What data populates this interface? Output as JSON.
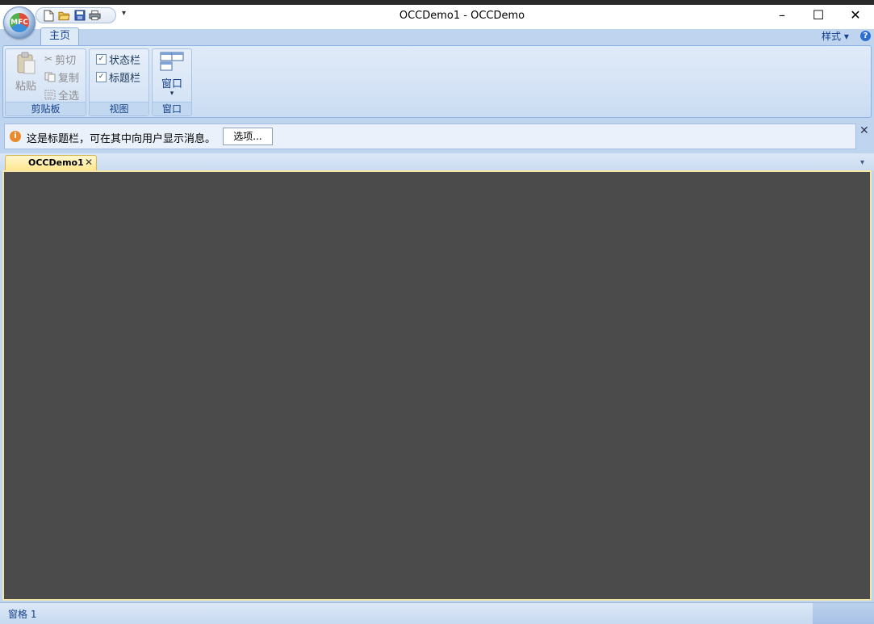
{
  "window": {
    "title": "OCCDemo1 - OCCDemo",
    "minimize_glyph": "–",
    "maximize_glyph": "☐",
    "close_glyph": "✕"
  },
  "app_button": {
    "logo_text": "MFC"
  },
  "quick_access": {
    "items": [
      "new-file-icon",
      "open-folder-icon",
      "save-disk-icon",
      "print-icon"
    ],
    "more_glyph": "▾"
  },
  "ribbon": {
    "tabs": [
      {
        "label": "主页",
        "active": true
      }
    ],
    "style_menu": "样式 ▾",
    "help_glyph": "?",
    "groups": {
      "clipboard": {
        "caption": "剪贴板",
        "paste": "粘贴",
        "cut": "剪切",
        "copy": "复制",
        "select_all": "全选"
      },
      "view": {
        "caption": "视图",
        "status_bar": "状态栏",
        "caption_bar": "标题栏",
        "check_glyph": "✓"
      },
      "window": {
        "caption": "窗口",
        "window_button": "窗口",
        "dropdown_glyph": "▾"
      }
    }
  },
  "message_bar": {
    "info_glyph": "i",
    "text": "这是标题栏，可在其中向用户显示消息。",
    "options_button": "选项...",
    "close_glyph": "✕"
  },
  "document_tabs": {
    "tabs": [
      {
        "label": "OCCDemo1",
        "active": true
      }
    ],
    "close_glyph": "✕",
    "more_glyph": "▾"
  },
  "status_bar": {
    "pane": "窗格 1"
  },
  "colors": {
    "ribbon_bg": "#d4e3f5",
    "viewport_bg": "#4b4b4b",
    "active_tab": "#ffe58a",
    "text_blue": "#15428b"
  }
}
